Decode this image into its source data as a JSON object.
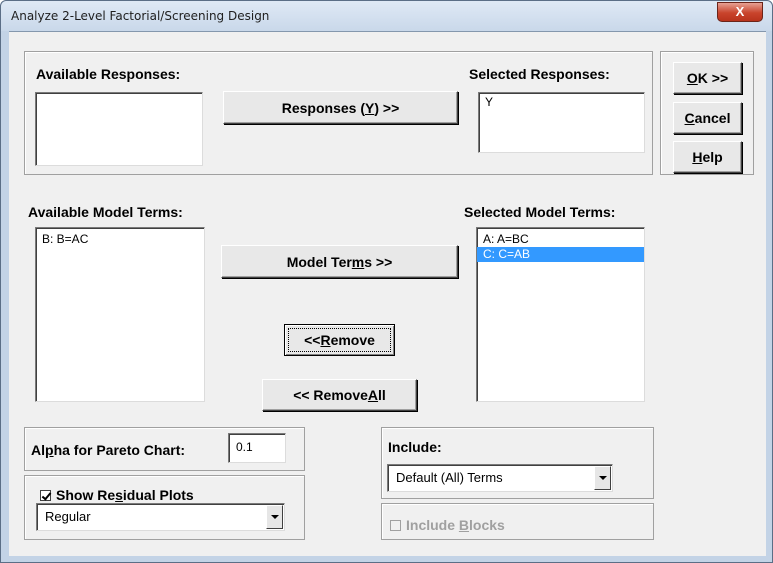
{
  "window": {
    "title": "Analyze 2-Level Factorial/Screening Design",
    "close_glyph": "X"
  },
  "responses": {
    "available_label": "Available Responses:",
    "selected_label": "Selected Responses:",
    "available_items": [],
    "selected_items": [
      "Y"
    ],
    "button_pre": "Responses (",
    "button_key": "Y",
    "button_post": ") >>"
  },
  "buttons": {
    "ok_key": "O",
    "ok_rest": "K >>",
    "cancel_key": "C",
    "cancel_rest": "ancel",
    "help_key": "H",
    "help_rest": "elp"
  },
  "model": {
    "available_label": "Available Model Terms:",
    "selected_label": "Selected Model Terms:",
    "available_items": [
      "B: B=AC"
    ],
    "selected_items": [
      "A: A=BC",
      "C: C=AB"
    ],
    "selected_index": 1,
    "terms_pre": "Model Ter",
    "terms_key": "m",
    "terms_post": "s  >>",
    "remove_pre": "<< ",
    "remove_key": "R",
    "remove_post": "emove",
    "remove_all_pre": "<< Remove ",
    "remove_all_key": "A",
    "remove_all_post": "ll"
  },
  "alpha": {
    "label_pre": "Al",
    "label_key": "p",
    "label_post": "ha for Pareto Chart:",
    "value": "0.1"
  },
  "residual": {
    "label_pre": "Show Re",
    "label_key": "s",
    "label_post": "idual Plots",
    "checked": true,
    "selected_option": "Regular"
  },
  "include": {
    "label": "Include:",
    "selected_option": "Default (All) Terms",
    "blocks_pre": "Include ",
    "blocks_key": "B",
    "blocks_post": "locks",
    "blocks_enabled": false
  }
}
